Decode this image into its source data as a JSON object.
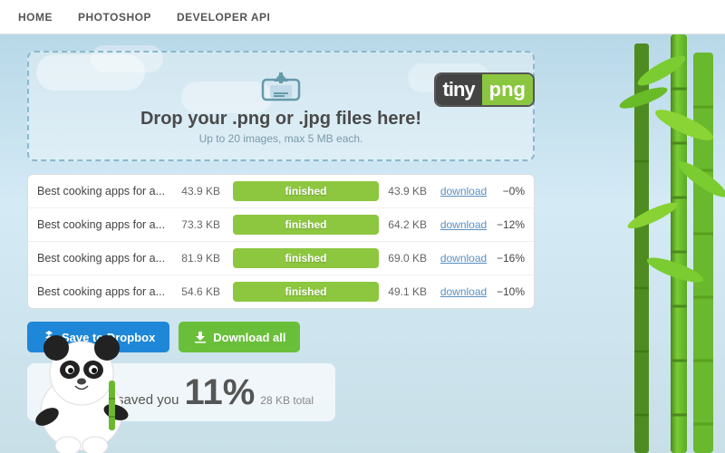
{
  "nav": {
    "items": [
      {
        "label": "HOME",
        "id": "home"
      },
      {
        "label": "PHOTOSHOP",
        "id": "photoshop"
      },
      {
        "label": "DEVELOPER API",
        "id": "developer-api"
      }
    ]
  },
  "logo": {
    "part1": "tiny",
    "part2": "png"
  },
  "dropzone": {
    "title": "Drop your .png or .jpg files here!",
    "subtitle": "Up to 20 images, max 5 MB each."
  },
  "files": [
    {
      "name": "Best cooking apps for a...",
      "orig_size": "43.9 KB",
      "new_size": "43.9 KB",
      "status": "finished",
      "savings": "−0%"
    },
    {
      "name": "Best cooking apps for a...",
      "orig_size": "73.3 KB",
      "new_size": "64.2 KB",
      "status": "finished",
      "savings": "−12%"
    },
    {
      "name": "Best cooking apps for a...",
      "orig_size": "81.9 KB",
      "new_size": "69.0 KB",
      "status": "finished",
      "savings": "−16%"
    },
    {
      "name": "Best cooking apps for a...",
      "orig_size": "54.6 KB",
      "new_size": "49.1 KB",
      "status": "finished",
      "savings": "−10%"
    }
  ],
  "buttons": {
    "dropbox": "Save to Dropbox",
    "download_all": "Download all"
  },
  "savings_banner": {
    "prefix": "Panda just saved you",
    "percent": "11%",
    "detail": "28 KB total"
  },
  "download_label": "download"
}
